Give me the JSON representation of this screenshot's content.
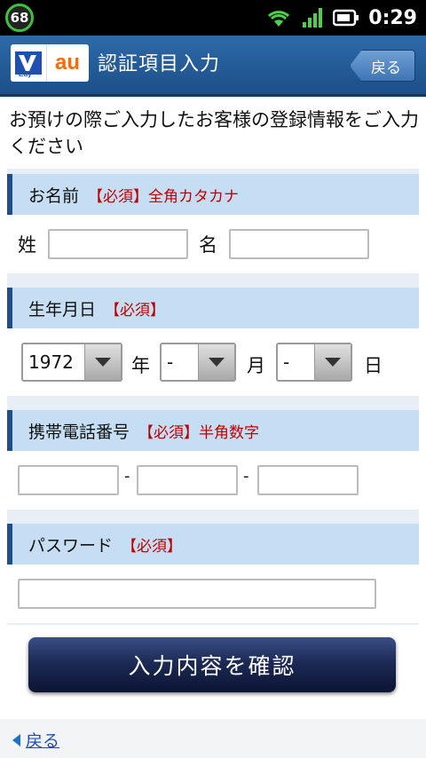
{
  "status_bar": {
    "battery_level": "68",
    "time": "0:29"
  },
  "header": {
    "logo_edy": "Edy",
    "logo_au": "au",
    "title": "認証項目入力",
    "back_label": "戻る"
  },
  "intro": "お預けの際ご入力したお客様の登録情報をご入力ください",
  "sections": {
    "name": {
      "title": "お名前",
      "req": "【必須】全角カタカナ",
      "sei_label": "姓",
      "mei_label": "名",
      "sei_value": "",
      "mei_value": ""
    },
    "birth": {
      "title": "生年月日",
      "req": "【必須】",
      "year": "1972",
      "year_unit": "年",
      "month": "-",
      "month_unit": "月",
      "day": "-",
      "day_unit": "日"
    },
    "phone": {
      "title": "携帯電話番号",
      "req": "【必須】半角数字",
      "sep": "-",
      "part1": "",
      "part2": "",
      "part3": ""
    },
    "password": {
      "title": "パスワード",
      "req": "【必須】",
      "value": ""
    }
  },
  "confirm_label": "入力内容を確認",
  "footer": {
    "back_link": "戻る"
  },
  "colors": {
    "header": "#1b4f88",
    "section_head": "#c6def3",
    "required": "#c00000",
    "link": "#1d4fb6"
  }
}
